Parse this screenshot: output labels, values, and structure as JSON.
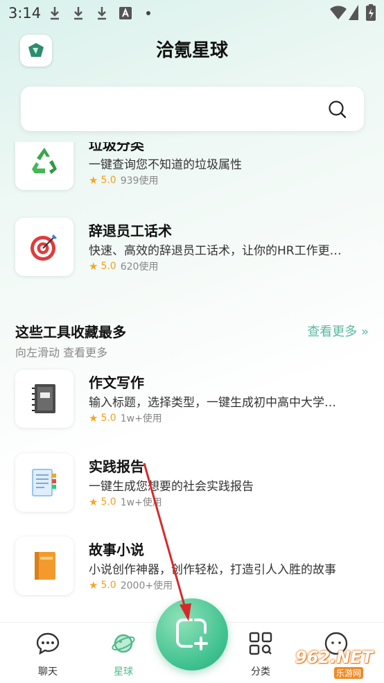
{
  "status_bar": {
    "time": "3:14"
  },
  "header": {
    "title": "洽氪星球"
  },
  "search": {
    "placeholder": ""
  },
  "tools_top": [
    {
      "name": "垃圾分类",
      "desc": "一键查询您不知道的垃圾属性",
      "rating": "5.0",
      "uses": "939使用",
      "icon": "recycle-icon"
    },
    {
      "name": "辞退员工话术",
      "desc": "快速、高效的辞退员工话术，让你的HR工作更…",
      "rating": "5.0",
      "uses": "620使用",
      "icon": "target-icon"
    }
  ],
  "section": {
    "title": "这些工具收藏最多",
    "subtitle": "向左滑动 查看更多",
    "more": "查看更多 »"
  },
  "tools_fav": [
    {
      "name": "作文写作",
      "desc": "输入标题，选择类型，一键生成初中高中大学…",
      "rating": "5.0",
      "uses": "1w+使用",
      "icon": "notebook-icon"
    },
    {
      "name": "实践报告",
      "desc": "一键生成您想要的社会实践报告",
      "rating": "5.0",
      "uses": "1w+使用",
      "icon": "document-icon"
    },
    {
      "name": "故事小说",
      "desc": "小说创作神器，创作轻松，打造引人入胜的故事",
      "rating": "5.0",
      "uses": "2000+使用",
      "icon": "book-icon"
    }
  ],
  "nav": {
    "chat": "聊天",
    "planet": "星球",
    "category": "分类"
  },
  "watermark": {
    "brand": "962.NET",
    "sub": "乐游网"
  },
  "colors": {
    "accent": "#3cc08e",
    "rating": "#f0a020",
    "more_link": "#5bb8a0"
  }
}
